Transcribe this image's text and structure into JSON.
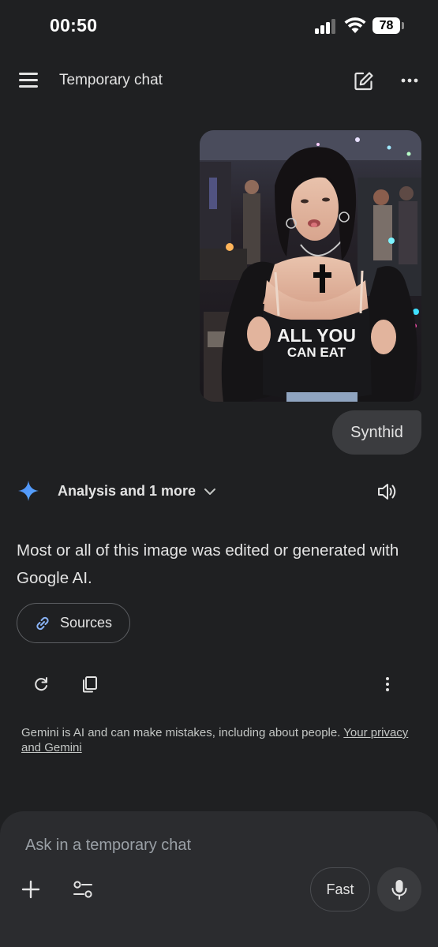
{
  "status_bar": {
    "time": "00:50",
    "battery": "78"
  },
  "header": {
    "title": "Temporary chat",
    "icons": [
      "menu-icon",
      "edit-icon",
      "more-horizontal-icon"
    ]
  },
  "conversation": {
    "user_image": {
      "shirt_text_line1": "ALL YOU",
      "shirt_text_line2": "CAN EAT"
    },
    "user_message": "Synthid",
    "model": {
      "tools_label": "Analysis and 1 more",
      "response": "Most or all of this image was edited or generated with Google AI.",
      "sources_label": "Sources"
    }
  },
  "disclaimer": {
    "text": "Gemini is AI and can make mistakes, including about people. ",
    "link": "Your privacy and Gemini"
  },
  "input": {
    "placeholder": "Ask in a temporary chat",
    "mode_label": "Fast"
  },
  "colors": {
    "background": "#1f2022",
    "bubble": "#3b3c3f",
    "input_panel": "#2b2c2f",
    "accent_blue": "#4c8df6",
    "text": "#e3e3e3"
  }
}
